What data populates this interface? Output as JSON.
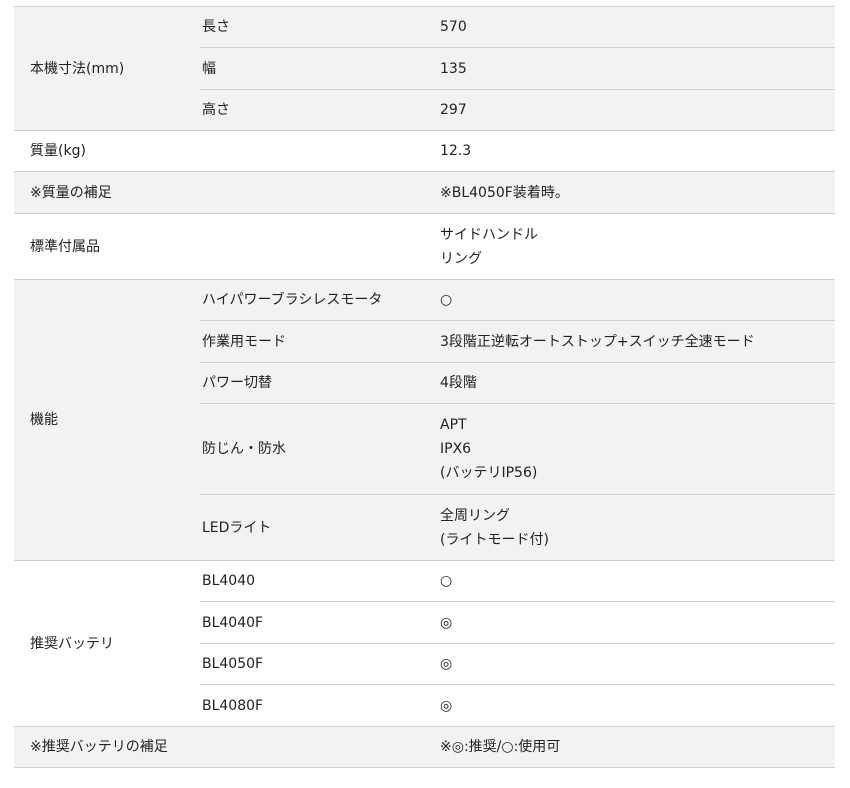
{
  "groups": [
    {
      "label": "本機寸法(mm)",
      "rows": [
        {
          "sub": "長さ",
          "value": [
            "570"
          ]
        },
        {
          "sub": "幅",
          "value": [
            "135"
          ]
        },
        {
          "sub": "高さ",
          "value": [
            "297"
          ]
        }
      ]
    },
    {
      "label": "質量(kg)",
      "rows": [
        {
          "sub": "",
          "value": [
            "12.3"
          ]
        }
      ]
    },
    {
      "label": "※質量の補足",
      "rows": [
        {
          "sub": "",
          "value": [
            "※BL4050F装着時。"
          ]
        }
      ]
    },
    {
      "label": "標準付属品",
      "rows": [
        {
          "sub": "",
          "value": [
            "サイドハンドル",
            "リング"
          ]
        }
      ]
    },
    {
      "label": "機能",
      "rows": [
        {
          "sub": "ハイパワーブラシレスモータ",
          "value": [
            "○"
          ]
        },
        {
          "sub": "作業用モード",
          "value": [
            "3段階正逆転オートストップ+スイッチ全速モード"
          ]
        },
        {
          "sub": "パワー切替",
          "value": [
            "4段階"
          ]
        },
        {
          "sub": "防じん・防水",
          "value": [
            "APT",
            "IPX6",
            "(バッテリIP56)"
          ]
        },
        {
          "sub": "LEDライト",
          "value": [
            "全周リング",
            "(ライトモード付)"
          ]
        }
      ]
    },
    {
      "label": "推奨バッテリ",
      "rows": [
        {
          "sub": "BL4040",
          "value": [
            "○"
          ]
        },
        {
          "sub": "BL4040F",
          "value": [
            "◎"
          ]
        },
        {
          "sub": "BL4050F",
          "value": [
            "◎"
          ]
        },
        {
          "sub": "BL4080F",
          "value": [
            "◎"
          ]
        }
      ]
    },
    {
      "label": "※推奨バッテリの補足",
      "rows": [
        {
          "sub": "",
          "value": [
            "※◎:推奨/○:使用可"
          ]
        }
      ]
    }
  ]
}
